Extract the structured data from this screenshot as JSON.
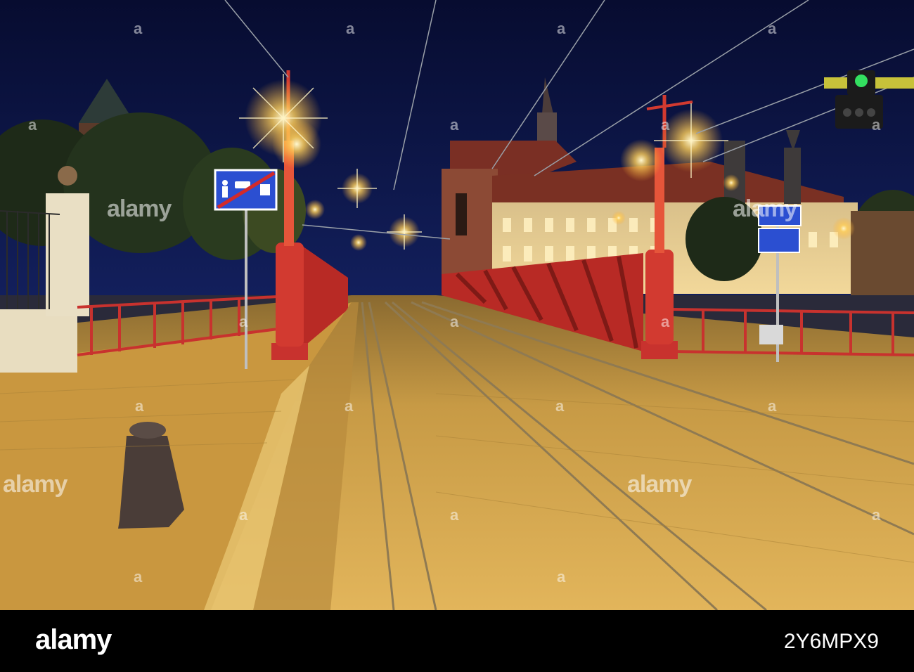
{
  "watermark": {
    "brand": "alamy",
    "mark": "a"
  },
  "footer": {
    "logo": "alamy",
    "image_id": "2Y6MPX9"
  },
  "colors": {
    "sky": "#0c1444",
    "bridge": "#c8322e",
    "lamp_glow": "#ffcc55",
    "cobblestone": "#d7a84a",
    "sign_blue": "#2b4fd1"
  }
}
